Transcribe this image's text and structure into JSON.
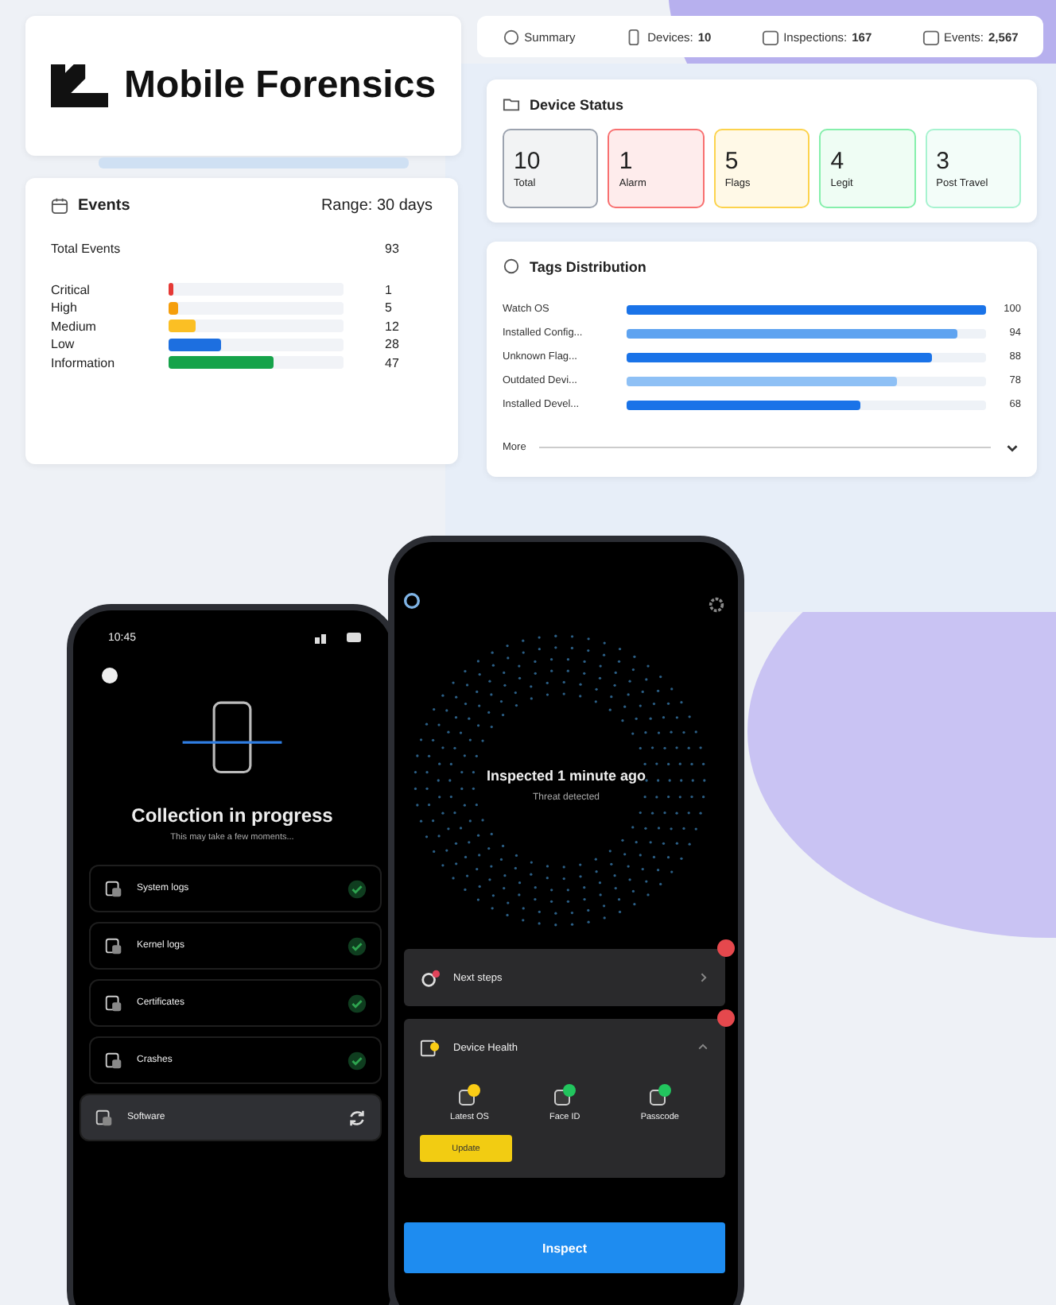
{
  "brand": {
    "name": "Mobile Forensics"
  },
  "events": {
    "title": "Events",
    "range": "Range: 30 days",
    "total_label": "Total Events",
    "total": "93",
    "rows": [
      {
        "label": "Critical",
        "value": "1",
        "level": 0.03,
        "color": "#e53935"
      },
      {
        "label": "High",
        "value": "5",
        "level": 0.05,
        "color": "#f59e0b"
      },
      {
        "label": "Medium",
        "value": "12",
        "level": 0.15,
        "color": "#fbbf24"
      },
      {
        "label": "Low",
        "value": "28",
        "level": 0.3,
        "color": "#1d6fe0"
      },
      {
        "label": "Information",
        "value": "47",
        "level": 0.6,
        "color": "#16a34a"
      }
    ]
  },
  "summary": [
    {
      "label": "Summary"
    },
    {
      "label": "Devices:",
      "value": "10"
    },
    {
      "label": "Inspections:",
      "value": "167"
    },
    {
      "label": "Events:",
      "value": "2,567"
    }
  ],
  "device_status": {
    "title": "Device Status",
    "tiles": [
      {
        "value": "10",
        "label": "Total",
        "color": "#9ca3af"
      },
      {
        "value": "1",
        "label": "Alarm",
        "color": "#f87171"
      },
      {
        "value": "5",
        "label": "Flags",
        "color": "#fcd34d"
      },
      {
        "value": "4",
        "label": "Legit",
        "color": "#86efac"
      },
      {
        "value": "3",
        "label": "Post Travel",
        "color": "#a7f3d0"
      }
    ]
  },
  "tags": {
    "title": "Tags Distribution",
    "more": "More",
    "rows": [
      {
        "label": "Watch OS",
        "value": "100",
        "level": 1.0,
        "color": "#1a73e8"
      },
      {
        "label": "Installed Config...",
        "value": "94",
        "level": 0.92,
        "color": "#5ea3f0"
      },
      {
        "label": "Unknown Flag...",
        "value": "88",
        "level": 0.85,
        "color": "#1a73e8"
      },
      {
        "label": "Outdated Devi...",
        "value": "78",
        "level": 0.75,
        "color": "#8ec0f5"
      },
      {
        "label": "Installed Devel...",
        "value": "68",
        "level": 0.65,
        "color": "#1a73e8"
      }
    ]
  },
  "phone_collection": {
    "time": "10:45",
    "title": "Collection in progress",
    "subtitle": "This may take a few moments...",
    "items": [
      {
        "label": "System logs",
        "done": true
      },
      {
        "label": "Kernel logs",
        "done": true
      },
      {
        "label": "Certificates",
        "done": true
      },
      {
        "label": "Crashes",
        "done": true
      },
      {
        "label": "Software",
        "done": false
      }
    ]
  },
  "phone_inspect": {
    "status": "Inspected 1 minute ago",
    "detail": "Threat detected",
    "sections": [
      {
        "label": "Next steps",
        "alert": true,
        "expanded": false
      },
      {
        "label": "Device Health",
        "alert": true,
        "expanded": true
      }
    ],
    "health": [
      {
        "label": "Latest OS",
        "color": "#facc15"
      },
      {
        "label": "Face ID",
        "color": "#22c55e"
      },
      {
        "label": "Passcode",
        "color": "#22c55e"
      }
    ],
    "update": "Update",
    "button": "Inspect"
  }
}
